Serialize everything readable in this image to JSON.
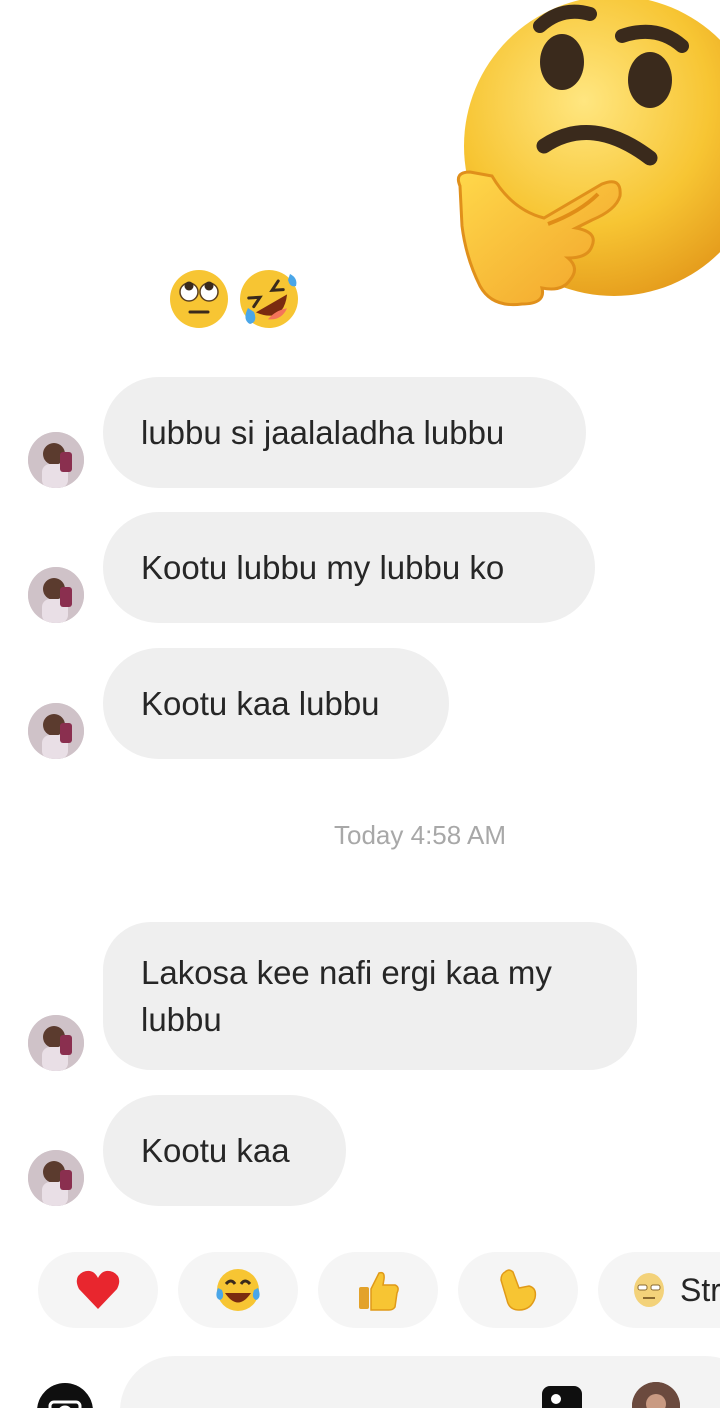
{
  "reactions_top": {
    "icons": [
      "face-with-rolling-eyes-icon",
      "rolling-on-floor-laughing-icon"
    ]
  },
  "overlay": {
    "icon": "thinking-face-icon"
  },
  "messages": [
    {
      "text": "lubbu si jaalaladha lubbu"
    },
    {
      "text": "Kootu lubbu my lubbu ko"
    },
    {
      "text": "Kootu kaa lubbu"
    },
    {
      "text": "Lakosa kee nafi ergi kaa my\nlubbu"
    },
    {
      "text": "Kootu kaa"
    }
  ],
  "timestamp": "Today 4:58 AM",
  "quick_reactions": {
    "items": [
      {
        "icon": "red-heart-icon"
      },
      {
        "icon": "tears-of-joy-icon"
      },
      {
        "icon": "thumbs-up-icon"
      },
      {
        "icon": "pointing-hand-icon"
      },
      {
        "icon": "sticker-face-icon",
        "label": "Str"
      }
    ]
  },
  "composer": {
    "icons": [
      "camera-icon",
      "gallery-icon",
      "profile-avatar"
    ]
  },
  "colors": {
    "bubble": "#efefef",
    "text": "#262626",
    "timestamp": "#a8a8a8",
    "emoji_yellow": "#f7c533"
  }
}
